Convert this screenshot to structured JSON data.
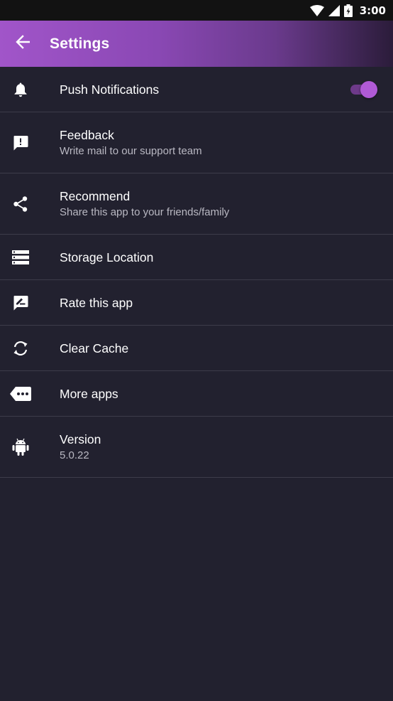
{
  "status_bar": {
    "time": "3:00",
    "icons": [
      "wifi-icon",
      "signal-icon",
      "battery-icon"
    ]
  },
  "app_bar": {
    "title": "Settings",
    "back_icon": "arrow-back-icon",
    "gradient_colors": [
      "#a155c9",
      "#2b1c3a"
    ]
  },
  "settings": {
    "push_notifications": {
      "title": "Push Notifications",
      "icon": "bell-icon",
      "toggle_on": true
    },
    "feedback": {
      "title": "Feedback",
      "subtitle": "Write mail to our support team",
      "icon": "feedback-icon"
    },
    "recommend": {
      "title": "Recommend",
      "subtitle": "Share this app to your friends/family",
      "icon": "share-icon"
    },
    "storage": {
      "title": "Storage Location",
      "icon": "storage-icon"
    },
    "rate": {
      "title": "Rate this app",
      "icon": "rate-review-icon"
    },
    "clear_cache": {
      "title": "Clear Cache",
      "icon": "sync-icon"
    },
    "more_apps": {
      "title": "More apps",
      "icon": "more-apps-icon"
    },
    "version": {
      "title": "Version",
      "subtitle": "5.0.22",
      "icon": "android-icon"
    }
  },
  "colors": {
    "background": "#22212f",
    "accent": "#b05ad6",
    "divider": "#3d3c4a",
    "secondary_text": "#b9b8c2"
  }
}
